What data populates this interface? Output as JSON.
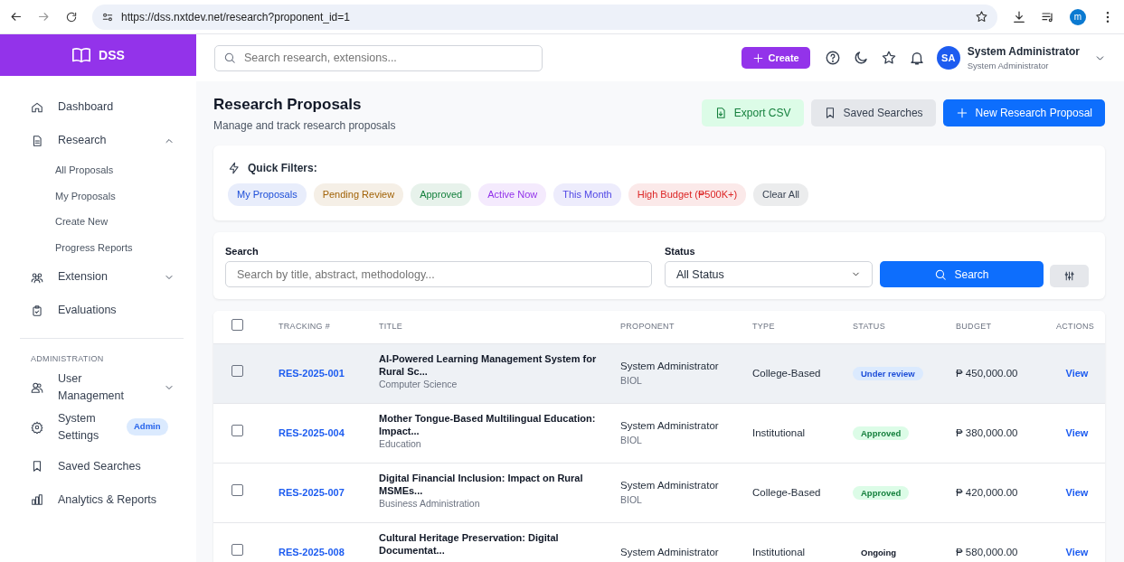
{
  "browser": {
    "url": "https://dss.nxtdev.net/research?proponent_id=1",
    "profile_initial": "m"
  },
  "sidebar": {
    "brand": "DSS",
    "items": [
      {
        "kind": "link",
        "label": "Dashboard"
      },
      {
        "kind": "group",
        "label": "Research",
        "expanded": true,
        "children": [
          {
            "label": "All Proposals"
          },
          {
            "label": "My Proposals"
          },
          {
            "label": "Create New"
          },
          {
            "label": "Progress Reports"
          }
        ]
      },
      {
        "kind": "group",
        "label": "Extension",
        "expanded": false
      },
      {
        "kind": "link",
        "label": "Evaluations"
      },
      {
        "kind": "section",
        "label": "ADMINISTRATION"
      },
      {
        "kind": "group",
        "label": "User Management",
        "expanded": false
      },
      {
        "kind": "link",
        "label": "System Settings",
        "badge": "Admin"
      },
      {
        "kind": "link",
        "label": "Saved Searches"
      },
      {
        "kind": "link",
        "label": "Analytics & Reports"
      }
    ]
  },
  "topbar": {
    "search_placeholder": "Search research, extensions...",
    "create_label": "Create",
    "user": {
      "initials": "SA",
      "name": "System Administrator",
      "role": "System Administrator"
    }
  },
  "page": {
    "title": "Research Proposals",
    "subtitle": "Manage and track research proposals",
    "actions": [
      {
        "kind": "export",
        "label": "Export CSV"
      },
      {
        "kind": "saved",
        "label": "Saved Searches"
      },
      {
        "kind": "new",
        "label": "New Research Proposal"
      }
    ]
  },
  "quick_filters": {
    "title": "Quick Filters:",
    "chips": [
      {
        "label": "My Proposals",
        "color": "#1d4ed8"
      },
      {
        "label": "Pending Review",
        "color": "#a16207"
      },
      {
        "label": "Approved",
        "color": "#15803d"
      },
      {
        "label": "Active Now",
        "color": "#9333ea"
      },
      {
        "label": "This Month",
        "color": "#4f46e5"
      },
      {
        "label": "High Budget (₱500K+)",
        "color": "#dc2626"
      },
      {
        "label": "Clear All",
        "color": "#374151"
      }
    ]
  },
  "search_form": {
    "search_label": "Search",
    "search_placeholder": "Search by title, abstract, methodology...",
    "status_label": "Status",
    "status_value": "All Status",
    "button": "Search"
  },
  "table": {
    "columns": [
      "TRACKING #",
      "TITLE",
      "PROPONENT",
      "TYPE",
      "STATUS",
      "BUDGET",
      "ACTIONS"
    ],
    "all_checked": false,
    "rows": [
      {
        "selected": true,
        "checked": false,
        "tracking": "RES-2025-001",
        "title": "AI-Powered Learning Management System for Rural Sc...",
        "department": "Computer Science",
        "proponent": "System Administrator",
        "unit": "BIOL",
        "type": "College-Based",
        "status": {
          "label": "Under review",
          "kind": "review"
        },
        "budget": "₱ 450,000.00",
        "action": "View"
      },
      {
        "selected": false,
        "checked": false,
        "tracking": "RES-2025-004",
        "title": "Mother Tongue-Based Multilingual Education: Impact...",
        "department": "Education",
        "proponent": "System Administrator",
        "unit": "BIOL",
        "type": "Institutional",
        "status": {
          "label": "Approved",
          "kind": "approved"
        },
        "budget": "₱ 380,000.00",
        "action": "View"
      },
      {
        "selected": false,
        "checked": false,
        "tracking": "RES-2025-007",
        "title": "Digital Financial Inclusion: Impact on Rural MSMEs...",
        "department": "Business Administration",
        "proponent": "System Administrator",
        "unit": "BIOL",
        "type": "College-Based",
        "status": {
          "label": "Approved",
          "kind": "approved"
        },
        "budget": "₱ 420,000.00",
        "action": "View"
      },
      {
        "selected": false,
        "checked": false,
        "tracking": "RES-2025-008",
        "title": "Cultural Heritage Preservation: Digital Documentat...",
        "proponent": "System Administrator",
        "type": "Institutional",
        "status": {
          "label": "Ongoing",
          "kind": "ongoing"
        },
        "budget": "₱ 580,000.00",
        "action": "View"
      }
    ]
  }
}
